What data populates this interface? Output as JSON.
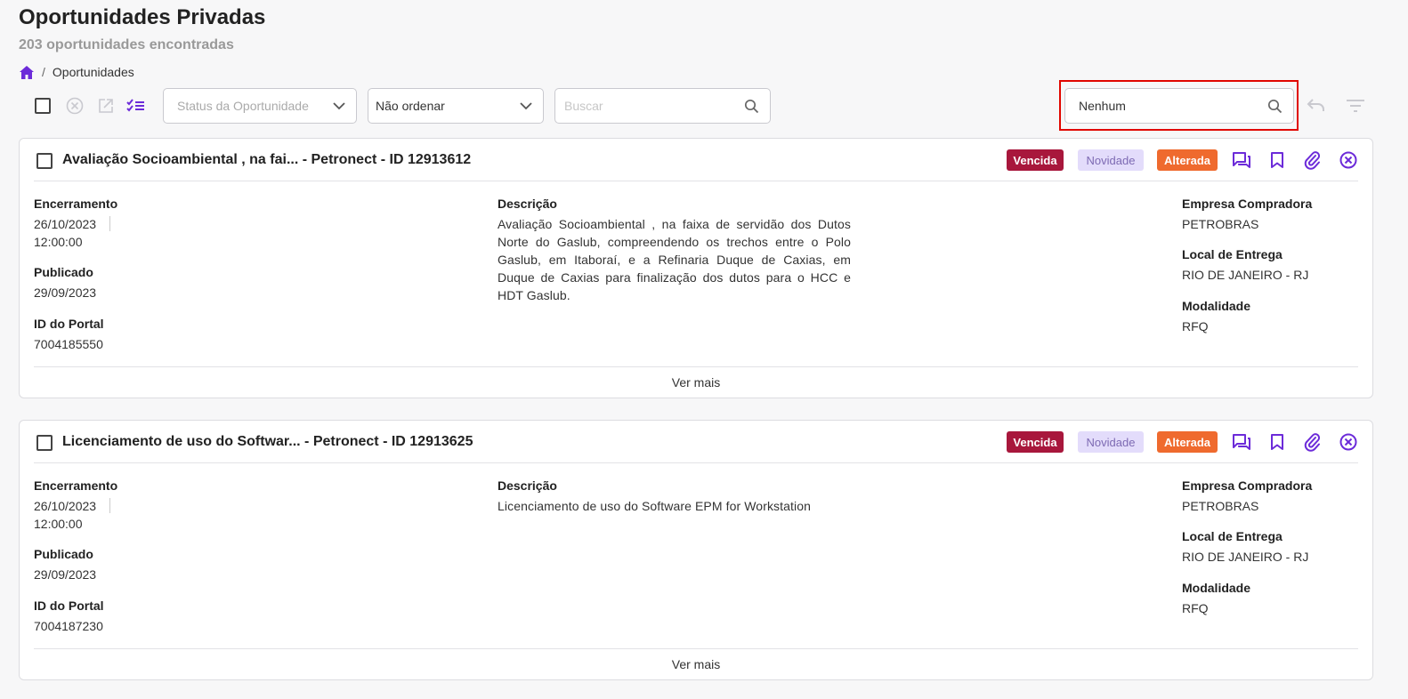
{
  "header": {
    "title": "Oportunidades Privadas",
    "subtitle": "203 oportunidades encontradas"
  },
  "breadcrumb": {
    "home_icon": "home-icon",
    "separator": "/",
    "current": "Oportunidades"
  },
  "toolbar": {
    "icons": [
      "checkbox",
      "cancel-circle-icon",
      "open-external-icon",
      "checklist-icon"
    ],
    "status_select": {
      "placeholder": "Status da Oportunidade"
    },
    "sort_select": {
      "value": "Não ordenar"
    },
    "search": {
      "placeholder": "Buscar",
      "value": ""
    },
    "saved_filter": {
      "value": "Nenhum"
    },
    "undo_icon": "undo-icon",
    "filter_icon": "filter-icon"
  },
  "colors": {
    "accent": "#6c2bd9",
    "vencida": "#a8173c",
    "novidade_bg": "#e3dcfb",
    "alterada": "#ef6a2e",
    "highlight": "#e10600"
  },
  "opportunities": [
    {
      "title": "Avaliação Socioambiental , na fai...  - Petronect - ID 12913612",
      "badges": {
        "vencida": "Vencida",
        "novidade": "Novidade",
        "alterada": "Alterada"
      },
      "encerramento_label": "Encerramento",
      "encerramento_date": "26/10/2023",
      "encerramento_time": "12:00:00",
      "publicado_label": "Publicado",
      "publicado": "29/09/2023",
      "portal_label": "ID do Portal",
      "portal_id": "7004185550",
      "descricao_label": "Descrição",
      "descricao": "Avaliação Socioambiental , na faixa de servidão dos Dutos Norte do Gaslub, compreendendo os trechos entre o Polo Gaslub, em Itaboraí, e a Refinaria Duque de Caxias, em Duque de Caxias para finalização dos dutos para o HCC e HDT Gaslub.",
      "empresa_label": "Empresa Compradora",
      "empresa": "PETROBRAS",
      "local_label": "Local de Entrega",
      "local": "RIO DE JANEIRO - RJ",
      "modalidade_label": "Modalidade",
      "modalidade": "RFQ",
      "ver_mais": "Ver mais"
    },
    {
      "title": "Licenciamento de uso do Softwar... - Petronect - ID 12913625",
      "badges": {
        "vencida": "Vencida",
        "novidade": "Novidade",
        "alterada": "Alterada"
      },
      "encerramento_label": "Encerramento",
      "encerramento_date": "26/10/2023",
      "encerramento_time": "12:00:00",
      "publicado_label": "Publicado",
      "publicado": "29/09/2023",
      "portal_label": "ID do Portal",
      "portal_id": "7004187230",
      "descricao_label": "Descrição",
      "descricao": "Licenciamento de uso do Software EPM for Workstation",
      "empresa_label": "Empresa Compradora",
      "empresa": "PETROBRAS",
      "local_label": "Local de Entrega",
      "local": "RIO DE JANEIRO - RJ",
      "modalidade_label": "Modalidade",
      "modalidade": "RFQ",
      "ver_mais": "Ver mais"
    }
  ]
}
